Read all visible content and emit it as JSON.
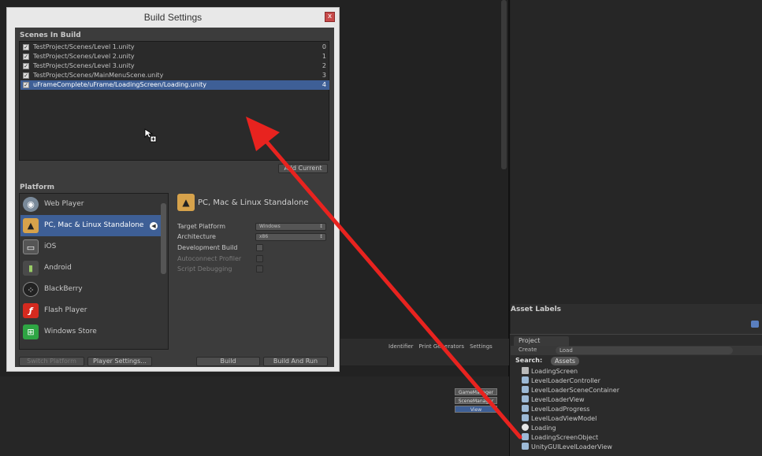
{
  "window": {
    "title": "Build Settings",
    "close_glyph": "x"
  },
  "scenes": {
    "header": "Scenes In Build",
    "items": [
      {
        "path": "TestProject/Scenes/Level 1.unity",
        "index": "0",
        "checked": true
      },
      {
        "path": "TestProject/Scenes/Level 2.unity",
        "index": "1",
        "checked": true
      },
      {
        "path": "TestProject/Scenes/Level 3.unity",
        "index": "2",
        "checked": true
      },
      {
        "path": "TestProject/Scenes/MainMenuScene.unity",
        "index": "3",
        "checked": true
      },
      {
        "path": "uFrameComplete/uFrame/LoadingScreen/Loading.unity",
        "index": "4",
        "checked": true,
        "selected": true
      }
    ],
    "add_current_label": "Add Current"
  },
  "platform": {
    "header": "Platform",
    "items": [
      {
        "name": "Web Player",
        "icon": "web-player-icon"
      },
      {
        "name": "PC, Mac & Linux Standalone",
        "icon": "standalone-icon",
        "selected": true
      },
      {
        "name": "iOS",
        "icon": "ios-icon"
      },
      {
        "name": "Android",
        "icon": "android-icon"
      },
      {
        "name": "BlackBerry",
        "icon": "blackberry-icon"
      },
      {
        "name": "Flash Player",
        "icon": "flash-icon"
      },
      {
        "name": "Windows Store",
        "icon": "windows-store-icon"
      }
    ],
    "selected_title": "PC, Mac & Linux Standalone",
    "options": {
      "target_platform_label": "Target Platform",
      "target_platform_value": "Windows",
      "architecture_label": "Architecture",
      "architecture_value": "x86",
      "development_build_label": "Development Build",
      "autoconnect_profiler_label": "Autoconnect Profiler",
      "script_debugging_label": "Script Debugging"
    }
  },
  "buttons": {
    "switch_platform": "Switch Platform",
    "player_settings": "Player Settings...",
    "build": "Build",
    "build_and_run": "Build And Run"
  },
  "background": {
    "ident_bar": [
      "Identifier",
      "Print Generators",
      "Settings"
    ],
    "tags": [
      "GameManager",
      "SceneManager",
      "View"
    ]
  },
  "project": {
    "asset_labels": "Asset Labels",
    "tab_label": "Project",
    "create_label": "Create",
    "search_value": "Load",
    "search_prefix": "Search:",
    "search_scope": "Assets",
    "assets": [
      {
        "name": "LoadingScreen",
        "kind": "folder"
      },
      {
        "name": "LevelLoaderController",
        "kind": "script"
      },
      {
        "name": "LevelLoaderSceneContainer",
        "kind": "script"
      },
      {
        "name": "LevelLoaderView",
        "kind": "script"
      },
      {
        "name": "LevelLoadProgress",
        "kind": "script"
      },
      {
        "name": "LevelLoadViewModel",
        "kind": "script"
      },
      {
        "name": "Loading",
        "kind": "scene"
      },
      {
        "name": "LoadingScreenObject",
        "kind": "script"
      },
      {
        "name": "UnityGUILevelLoaderView",
        "kind": "script"
      }
    ]
  },
  "colors": {
    "annotation_arrow": "#e8231f",
    "selection": "#3e5f96"
  }
}
